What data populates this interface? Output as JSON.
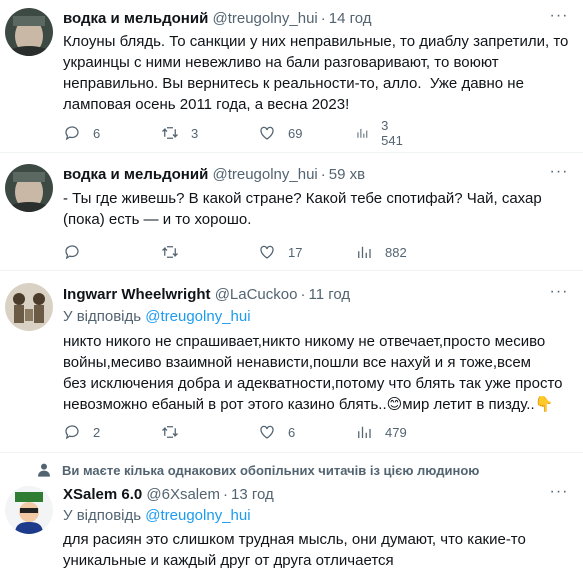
{
  "tweets": [
    {
      "name": "водка и мельдоний",
      "handle": "@treugolny_hui",
      "time": "14 год",
      "text": "Клоуны блядь. То санкции у них неправильные, то диаблу запретили, то\nукраинцы с ними невежливо на бали разговаривают, то воюют\nнеправильно. Вы вернитесь к реальности-то, алло.  Уже давно не\nламповая осень 2011 года, а весна 2023!",
      "replies": "6",
      "retweets": "3",
      "likes": "69",
      "views": "3 541"
    },
    {
      "name": "водка и мельдоний",
      "handle": "@treugolny_hui",
      "time": "59 хв",
      "text": "- Ты где живешь? В какой стране? Какой тебе спотифай? Чай, сахар\n(пока) есть — и то хорошо.",
      "replies": "",
      "retweets": "",
      "likes": "17",
      "views": "882"
    },
    {
      "name": "Ingwarr Wheelwright",
      "handle": "@LaCuckoo",
      "time": "11 год",
      "reply_prefix": "У відповідь",
      "reply_to": "@treugolny_hui",
      "text": "никто никого не спрашивает,никто никому не отвечает,просто месиво\nвойны,месиво взаимной ненависти,пошли все нахуй и я тоже,всем\nбез исключения добра и адекватности,потому что блять так уже просто\nневозможно ебаный в рот этого казино блять..😊мир летит в пизду..👇",
      "replies": "2",
      "retweets": "",
      "likes": "6",
      "views": "479"
    },
    {
      "social_context": "Ви маєте кілька однакових обопільних читачів із цією людиною",
      "name": "XSalem 6.0",
      "handle": "@6Xsalem",
      "time": "13 год",
      "reply_prefix": "У відповідь",
      "reply_to": "@treugolny_hui",
      "text": "для расиян это слишком трудная мысль, они думают, что какие-то\nуникальные и каждый друг от друга отличается"
    }
  ],
  "separator": "·",
  "more_glyph": "···",
  "colors": {
    "text": "#0f1419",
    "secondary": "#536471",
    "link": "#1d9bf0",
    "divider": "#eff3f4"
  }
}
